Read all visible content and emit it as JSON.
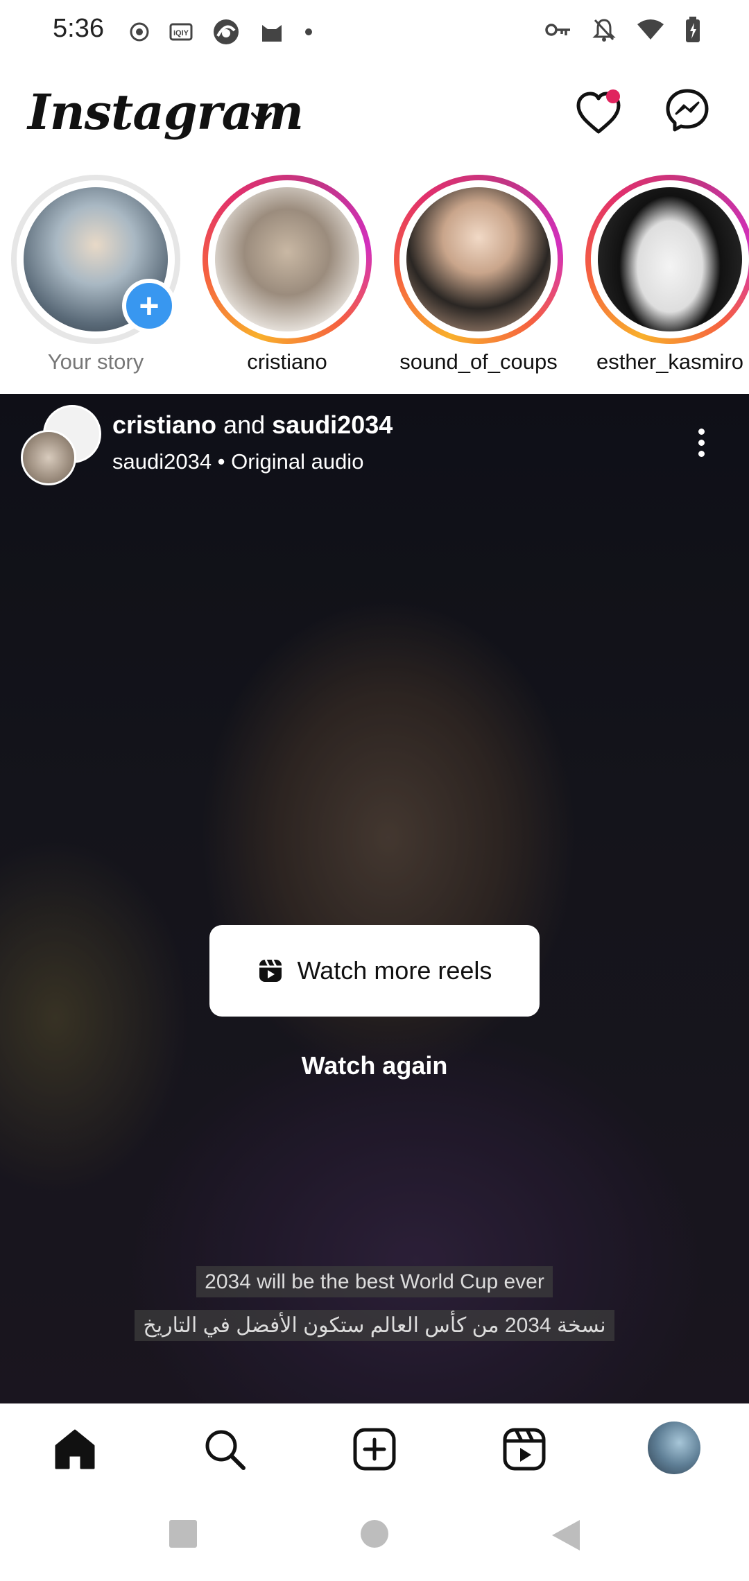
{
  "status_bar": {
    "time": "5:36",
    "left_icons": [
      "record-icon",
      "iqiyi-icon",
      "browser-icon",
      "cat-icon",
      "dot-icon"
    ],
    "right_icons": [
      "vpn-key-icon",
      "silent-bell-icon",
      "wifi-icon",
      "battery-charging-icon"
    ]
  },
  "header": {
    "logo_text": "Instagram",
    "icons": [
      "chevron-down-icon",
      "heart-icon",
      "messenger-icon"
    ],
    "notification_dot_color": "#e0245e"
  },
  "stories": [
    {
      "name": "Your story",
      "own": true
    },
    {
      "name": "cristiano",
      "own": false
    },
    {
      "name": "sound_of_coups",
      "own": false
    },
    {
      "name": "esther_kasmiro",
      "own": false
    }
  ],
  "post": {
    "author_primary": "cristiano",
    "author_joiner": "and",
    "author_secondary": "saudi2034",
    "subline": "saudi2034 • Original audio",
    "watch_more_label": "Watch more reels",
    "watch_again_label": "Watch again",
    "caption_line1": "2034 will be the best World Cup ever",
    "caption_line2": "نسخة 2034 من كأس العالم ستكون الأفضل في التاريخ"
  },
  "bottom_nav": {
    "items": [
      "home-icon",
      "search-icon",
      "create-icon",
      "reels-icon",
      "profile-avatar"
    ]
  },
  "system_nav": {
    "items": [
      "recents-button",
      "home-button",
      "back-button"
    ]
  },
  "colors": {
    "story_ring": "#d62976",
    "add_badge": "#3897f0",
    "text_primary": "#111111",
    "text_muted": "#777777"
  }
}
